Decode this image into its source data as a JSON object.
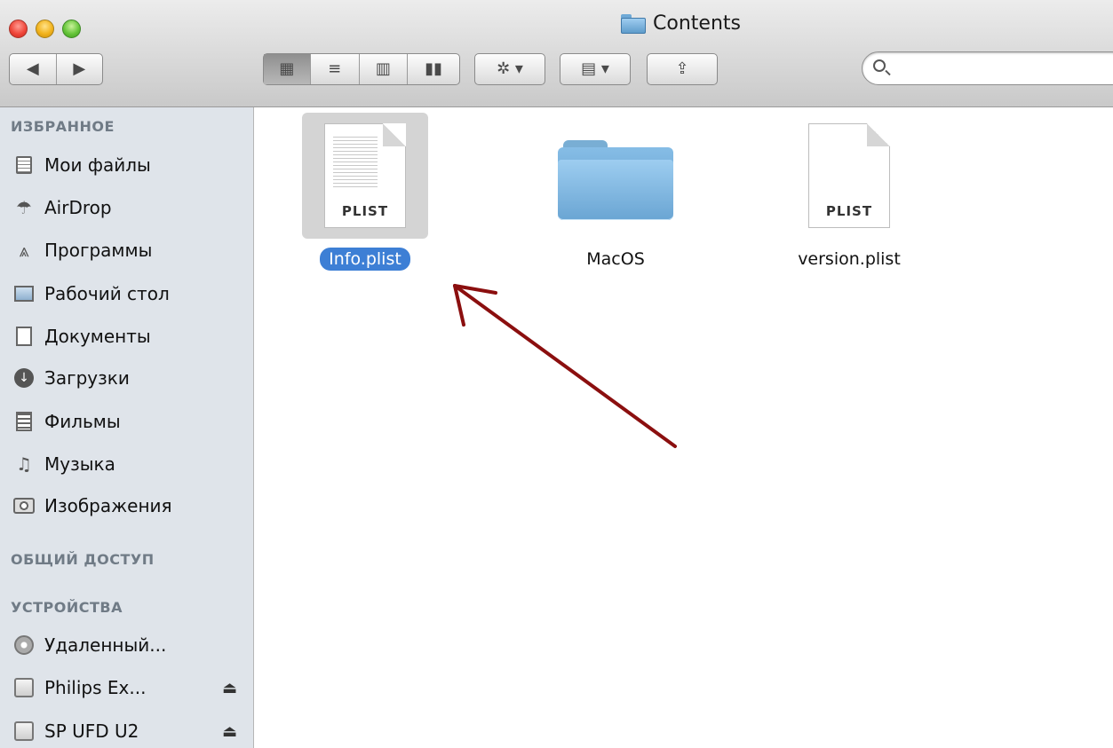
{
  "window": {
    "title": "Contents"
  },
  "toolbar": {
    "back_symbol": "◀",
    "forward_symbol": "▶",
    "view_icons_symbol": "▦",
    "view_list_symbol": "≡",
    "view_columns_symbol": "▥",
    "view_coverflow_symbol": "▮▮",
    "action_symbol": "✲ ▾",
    "arrange_symbol": "▤ ▾",
    "share_symbol": "⇪",
    "search_placeholder": ""
  },
  "sidebar": {
    "favorites_header": "ИЗБРАННОЕ",
    "favorites": [
      {
        "label": "Мои файлы",
        "icon": "all-files-icon"
      },
      {
        "label": "AirDrop",
        "icon": "airdrop-icon"
      },
      {
        "label": "Программы",
        "icon": "applications-icon"
      },
      {
        "label": "Рабочий стол",
        "icon": "desktop-icon"
      },
      {
        "label": "Документы",
        "icon": "documents-icon"
      },
      {
        "label": "Загрузки",
        "icon": "downloads-icon"
      },
      {
        "label": "Фильмы",
        "icon": "movies-icon"
      },
      {
        "label": "Музыка",
        "icon": "music-icon"
      },
      {
        "label": "Изображения",
        "icon": "pictures-icon"
      }
    ],
    "shared_header": "ОБЩИЙ ДОСТУП",
    "devices_header": "УСТРОЙСТВА",
    "devices": [
      {
        "label": "Удаленный...",
        "icon": "remote-disc-icon",
        "eject": false
      },
      {
        "label": "Philips Ex...",
        "icon": "time-machine-drive-icon",
        "eject": true
      },
      {
        "label": "SP UFD U2",
        "icon": "usb-drive-icon",
        "eject": true
      }
    ],
    "eject_symbol": "⏏"
  },
  "files": [
    {
      "name": "Info.plist",
      "type": "document",
      "ext": "PLIST",
      "selected": true
    },
    {
      "name": "MacOS",
      "type": "folder",
      "ext": "",
      "selected": false
    },
    {
      "name": "version.plist",
      "type": "document",
      "ext": "PLIST",
      "selected": false
    }
  ],
  "colors": {
    "selection": "#3d7fd5",
    "arrow": "#8b0f0f",
    "sidebar_bg": "#dfe4ea"
  }
}
